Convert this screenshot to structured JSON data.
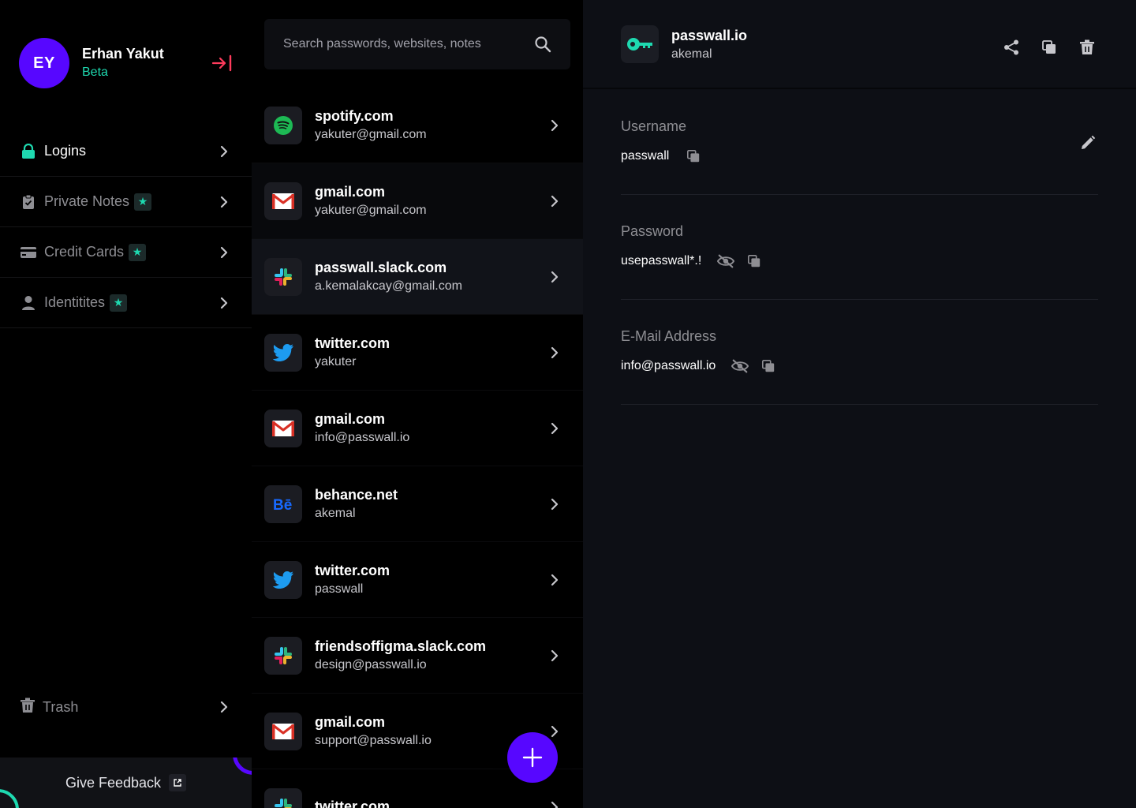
{
  "profile": {
    "initials": "EY",
    "name": "Erhan Yakut",
    "badge": "Beta"
  },
  "nav": {
    "items": [
      {
        "label": "Logins",
        "icon": "lock-icon",
        "active": true
      },
      {
        "label": "Private Notes",
        "icon": "clipboard-icon",
        "badge": "★"
      },
      {
        "label": "Credit Cards",
        "icon": "credit-card-icon",
        "badge": "★"
      },
      {
        "label": "Identitites",
        "icon": "person-icon",
        "badge": "★"
      }
    ],
    "trash_label": "Trash",
    "feedback_label": "Give Feedback"
  },
  "search": {
    "placeholder": "Search passwords, websites, notes"
  },
  "list": {
    "items": [
      {
        "title": "spotify.com",
        "subtitle": "yakuter@gmail.com",
        "logo": "spotify-logo"
      },
      {
        "title": "gmail.com",
        "subtitle": "yakuter@gmail.com",
        "logo": "gmail-logo"
      },
      {
        "title": "passwall.slack.com",
        "subtitle": "a.kemalakcay@gmail.com",
        "logo": "slack-logo",
        "selected": true
      },
      {
        "title": "twitter.com",
        "subtitle": "yakuter",
        "logo": "twitter-logo"
      },
      {
        "title": "gmail.com",
        "subtitle": "info@passwall.io",
        "logo": "gmail-logo"
      },
      {
        "title": "behance.net",
        "subtitle": "akemal",
        "logo": "behance-logo"
      },
      {
        "title": "twitter.com",
        "subtitle": "passwall",
        "logo": "twitter-logo"
      },
      {
        "title": "friendsoffigma.slack.com",
        "subtitle": "design@passwall.io",
        "logo": "slack-logo"
      },
      {
        "title": "gmail.com",
        "subtitle": "support@passwall.io",
        "logo": "gmail-logo"
      },
      {
        "title": "twitter.com",
        "subtitle": "",
        "logo": "slack-logo"
      }
    ]
  },
  "detail": {
    "title": "passwall.io",
    "subtitle": "akemal",
    "fields": [
      {
        "label": "Username",
        "value": "passwall"
      },
      {
        "label": "Password",
        "value": "usepasswall*.!"
      },
      {
        "label": "E-Mail Address",
        "value": "info@passwall.io"
      }
    ]
  },
  "colors": {
    "accent": "#5707ff",
    "teal": "#1ed9b0",
    "logout": "#ff3b5c"
  }
}
